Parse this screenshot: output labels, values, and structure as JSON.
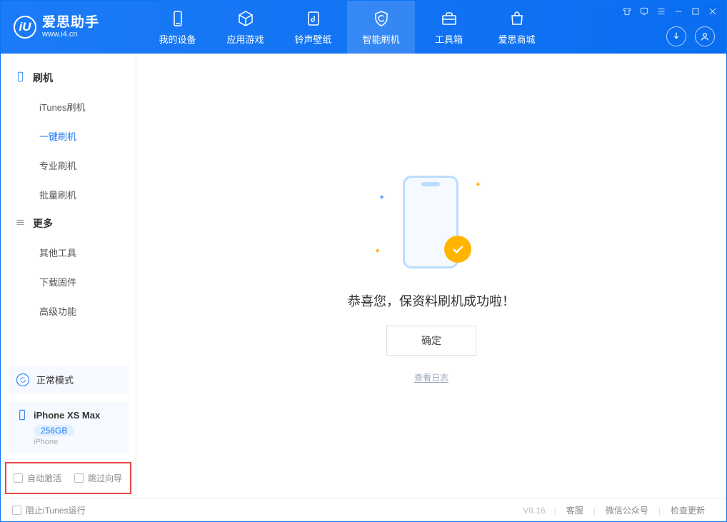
{
  "app": {
    "name_cn": "爱思助手",
    "url": "www.i4.cn",
    "logo_letter": "iU"
  },
  "tabs": [
    {
      "label": "我的设备"
    },
    {
      "label": "应用游戏"
    },
    {
      "label": "铃声壁纸"
    },
    {
      "label": "智能刷机"
    },
    {
      "label": "工具箱"
    },
    {
      "label": "爱思商城"
    }
  ],
  "sidebar": {
    "section1": {
      "title": "刷机"
    },
    "items1": [
      {
        "label": "iTunes刷机"
      },
      {
        "label": "一键刷机"
      },
      {
        "label": "专业刷机"
      },
      {
        "label": "批量刷机"
      }
    ],
    "section2": {
      "title": "更多"
    },
    "items2": [
      {
        "label": "其他工具"
      },
      {
        "label": "下载固件"
      },
      {
        "label": "高级功能"
      }
    ]
  },
  "mode": {
    "label": "正常模式"
  },
  "device": {
    "name": "iPhone XS Max",
    "storage": "256GB",
    "type": "iPhone"
  },
  "bottom_opts": {
    "auto_activate": "自动激活",
    "skip_guide": "跳过向导"
  },
  "main": {
    "success_text": "恭喜您，保资料刷机成功啦！",
    "ok": "确定",
    "log": "查看日志"
  },
  "status": {
    "block_itunes": "阻止iTunes运行",
    "version": "V8.16",
    "service": "客服",
    "wechat": "微信公众号",
    "update": "检查更新"
  }
}
